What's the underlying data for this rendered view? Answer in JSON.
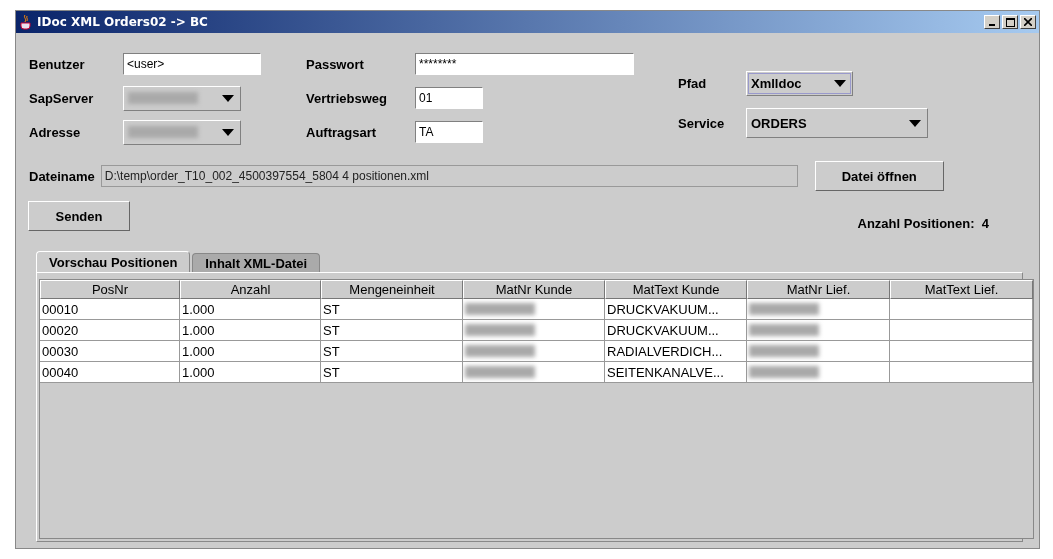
{
  "window": {
    "title": "IDoc XML Orders02 -> BC"
  },
  "form": {
    "benutzer": {
      "label": "Benutzer",
      "value": "<user>"
    },
    "passwort": {
      "label": "Passwort",
      "value": "********"
    },
    "sapserver": {
      "label": "SapServer",
      "redacted": true
    },
    "vertriebsweg": {
      "label": "Vertriebsweg",
      "value": "01"
    },
    "adresse": {
      "label": "Adresse",
      "redacted": true
    },
    "auftragsart": {
      "label": "Auftragsart",
      "value": "TA"
    },
    "pfad": {
      "label": "Pfad",
      "value": "Xmlldoc",
      "focused": true
    },
    "service": {
      "label": "Service",
      "value": "ORDERS"
    },
    "dateiname": {
      "label": "Dateiname",
      "value": "D:\\temp\\order_T10_002_4500397554_5804 4 positionen.xml"
    }
  },
  "buttons": {
    "open": "Datei öffnen",
    "send": "Senden"
  },
  "count": {
    "label": "Anzahl Positionen:",
    "value": "4"
  },
  "tabs": [
    {
      "label": "Vorschau Positionen",
      "selected": true
    },
    {
      "label": "Inhalt XML-Datei",
      "selected": false
    }
  ],
  "table": {
    "columns": [
      "PosNr",
      "Anzahl",
      "Mengeneinheit",
      "MatNr Kunde",
      "MatText Kunde",
      "MatNr Lief.",
      "MatText Lief."
    ],
    "rows": [
      [
        "00010",
        "1.000",
        "ST",
        null,
        "DRUCKVAKUUM...",
        null,
        ""
      ],
      [
        "00020",
        "1.000",
        "ST",
        null,
        "DRUCKVAKUUM...",
        null,
        ""
      ],
      [
        "00030",
        "1.000",
        "ST",
        null,
        "RADIALVERDICH...",
        null,
        ""
      ],
      [
        "00040",
        "1.000",
        "ST",
        null,
        "SEITENKANALVE...",
        null,
        ""
      ]
    ]
  }
}
